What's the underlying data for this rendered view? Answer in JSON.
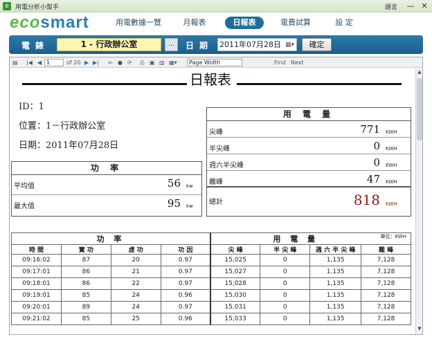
{
  "window": {
    "title": "用電分析小幫手",
    "lang": "語言",
    "min_glyph": "—",
    "close_glyph": "✕"
  },
  "logo": {
    "part1": "eco",
    "part2": "smart"
  },
  "nav": [
    {
      "label": "用電數據一覽",
      "active": false
    },
    {
      "label": "月報表",
      "active": false
    },
    {
      "label": "日報表",
      "active": true
    },
    {
      "label": "電費試算",
      "active": false
    },
    {
      "label": "設 定",
      "active": false
    }
  ],
  "toolbar": {
    "meter_label": "電錶",
    "meter_value": "1 - 行政辦公室",
    "meter_drop": "...",
    "date_label": "日期",
    "date_value": "2011年07月28日",
    "date_icon": "▦▾",
    "confirm": "確定"
  },
  "viewer": {
    "page_current": "1",
    "page_of": "of 20",
    "zoom": "Page Width",
    "find": "Find",
    "next": "Next"
  },
  "report": {
    "title": "日報表",
    "id_label": "ID：",
    "id_value": "1",
    "location_label": "位置：",
    "location_value": "1－行政辦公室",
    "date_label": "日期：",
    "date_value": "2011年07月28日",
    "power": {
      "heading": "功 率",
      "rows": [
        {
          "label": "平均值",
          "value": "56",
          "unit": "kw"
        },
        {
          "label": "最大值",
          "value": "95",
          "unit": "kw"
        }
      ]
    },
    "energy": {
      "heading": "用 電 量",
      "rows": [
        {
          "label": "尖峰",
          "value": "771",
          "unit": "KWH"
        },
        {
          "label": "半尖峰",
          "value": "0",
          "unit": "KWH"
        },
        {
          "label": "週六半尖峰",
          "value": "0",
          "unit": "KWH"
        },
        {
          "label": "離峰",
          "value": "47",
          "unit": "KWH"
        }
      ],
      "total_label": "總計",
      "total_value": "818",
      "total_unit": "KWH",
      "total_color": "#8b1a1a"
    },
    "table": {
      "group_power": "功 率",
      "group_energy": "用 電 量",
      "unit_note": "單位：KWH",
      "headers": [
        "時 間",
        "實 功",
        "虛 功",
        "功 因",
        "尖 峰",
        "半 尖 峰",
        "週 六 半 尖 峰",
        "離 峰"
      ],
      "rows": [
        [
          "09:16:02",
          "87",
          "20",
          "0.97",
          "15,025",
          "0",
          "1,135",
          "7,128"
        ],
        [
          "09:17:01",
          "86",
          "21",
          "0.97",
          "15,027",
          "0",
          "1,135",
          "7,128"
        ],
        [
          "09:18:01",
          "86",
          "22",
          "0.97",
          "15,028",
          "0",
          "1,135",
          "7,128"
        ],
        [
          "09:19:01",
          "85",
          "24",
          "0.96",
          "15,030",
          "0",
          "1,135",
          "7,128"
        ],
        [
          "09:20:01",
          "89",
          "24",
          "0.97",
          "15,031",
          "0",
          "1,135",
          "7,128"
        ],
        [
          "09:21:02",
          "85",
          "25",
          "0.96",
          "15,033",
          "0",
          "1,135",
          "7,128"
        ]
      ]
    }
  }
}
